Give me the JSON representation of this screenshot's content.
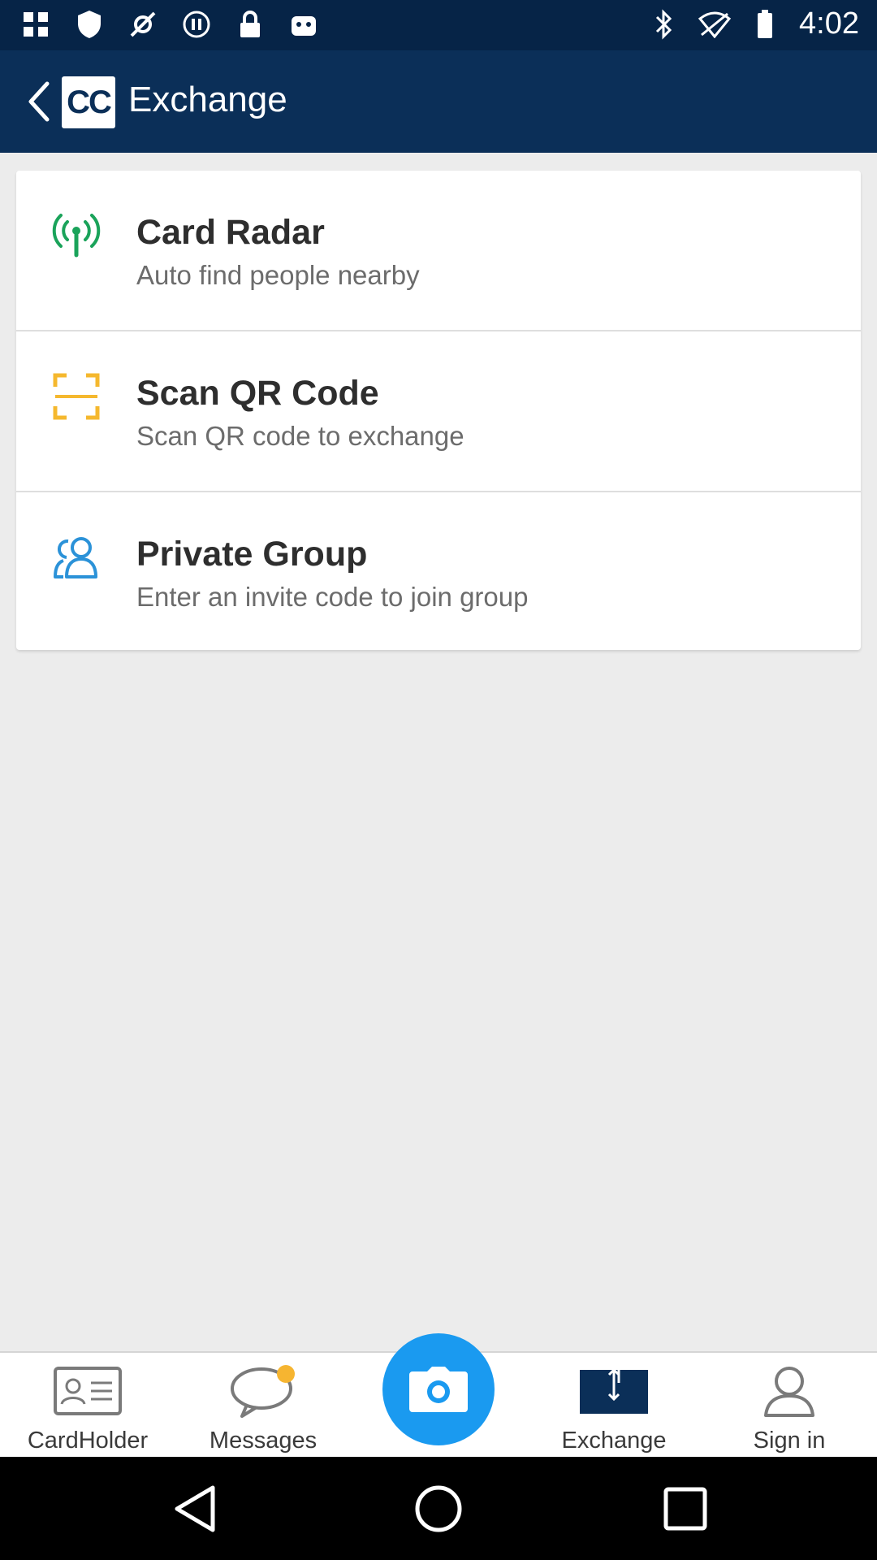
{
  "status_bar": {
    "time": "4:02",
    "left_icons": [
      "photo-icon",
      "shield-icon",
      "fake-gps-icon",
      "pause-icon",
      "lock-icon",
      "android-icon"
    ],
    "right_icons": [
      "bluetooth-icon",
      "wifi-off-icon",
      "battery-icon"
    ]
  },
  "app_bar": {
    "logo_text": "CC",
    "title": "Exchange"
  },
  "options": [
    {
      "title": "Card Radar",
      "subtitle": "Auto find people nearby",
      "icon": "radar-icon",
      "color": "#1aa35a"
    },
    {
      "title": "Scan QR Code",
      "subtitle": "Scan QR code to exchange",
      "icon": "scan-frame-icon",
      "color": "#f5b82e"
    },
    {
      "title": "Private Group",
      "subtitle": "Enter an invite code to join group",
      "icon": "group-icon",
      "color": "#2b92d8"
    }
  ],
  "bottom_nav": {
    "items": [
      {
        "label": "CardHolder",
        "icon": "cardholder-icon"
      },
      {
        "label": "Messages",
        "icon": "chat-bubble-icon"
      },
      {
        "label": "Exchange",
        "icon": "exchange-icon"
      },
      {
        "label": "Sign in",
        "icon": "person-icon"
      }
    ],
    "camera_icon": "camera-icon",
    "camera_color": "#1a9af0",
    "badge_color": "#f6b531"
  },
  "colors": {
    "app_bar": "#0b2f58",
    "status_bar": "#062447",
    "background": "#ececec"
  }
}
